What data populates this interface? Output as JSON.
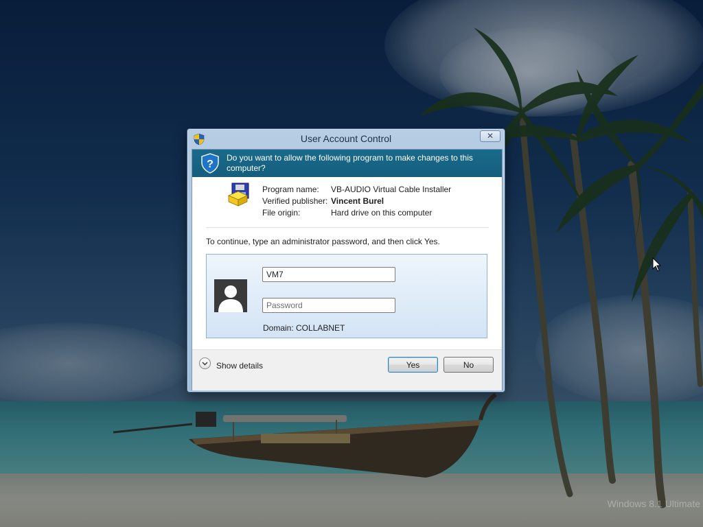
{
  "dialog": {
    "title": "User Account Control",
    "close_glyph": "✕",
    "question": "Do you want to allow the following program to make changes to this computer?",
    "program": {
      "name_label": "Program name:",
      "name_value": "VB-AUDIO Virtual Cable Installer",
      "publisher_label": "Verified publisher:",
      "publisher_value": "Vincent Burel",
      "origin_label": "File origin:",
      "origin_value": "Hard drive on this computer"
    },
    "instruction": "To continue, type an administrator password, and then click Yes.",
    "credentials": {
      "username_value": "VM7",
      "password_placeholder": "Password",
      "domain": "Domain: COLLABNET"
    },
    "show_details_label": "Show details",
    "yes_label": "Yes",
    "no_label": "No",
    "colors": {
      "banner": "#1a6b8c",
      "frame": "#b7cde3",
      "panel": "#d3e4f5"
    }
  },
  "desktop": {
    "watermark": "Windows 8.1 Ultimate"
  }
}
